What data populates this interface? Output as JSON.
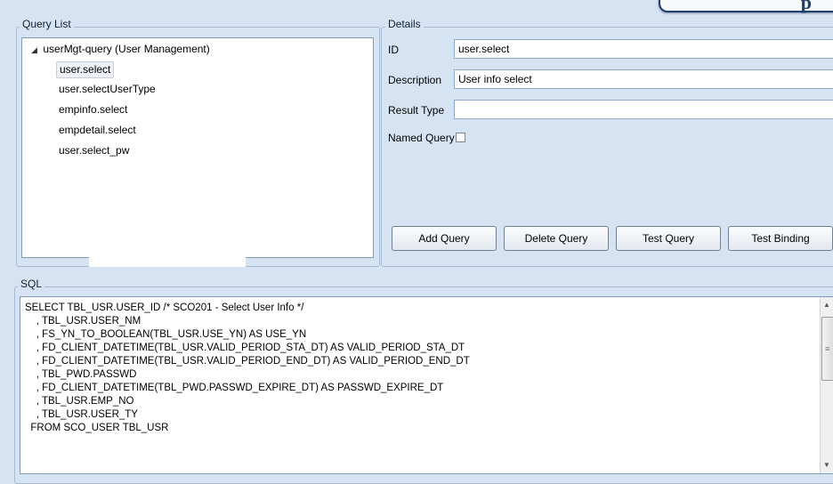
{
  "query_list": {
    "title": "Query List",
    "root": "userMgt-query (User Management)",
    "items": [
      {
        "label": "user.select",
        "selected": true
      },
      {
        "label": "user.selectUserType",
        "selected": false
      },
      {
        "label": "empinfo.select",
        "selected": false
      },
      {
        "label": "empdetail.select",
        "selected": false
      },
      {
        "label": "user.select_pw",
        "selected": false
      }
    ]
  },
  "details": {
    "title": "Details",
    "id_label": "ID",
    "id_value": "user.select",
    "description_label": "Description",
    "description_value": "User info select",
    "result_type_label": "Result Type",
    "result_type_value": "",
    "named_query_label": "Named Query",
    "named_query_checked": false,
    "buttons": {
      "add": "Add Query",
      "delete": "Delete Query",
      "test": "Test Query",
      "binding": "Test Binding"
    }
  },
  "sql": {
    "title": "SQL",
    "lines": [
      "SELECT TBL_USR.USER_ID /* SCO201 - Select User Info */",
      "    , TBL_USR.USER_NM",
      "    , FS_YN_TO_BOOLEAN(TBL_USR.USE_YN) AS USE_YN",
      "    , FD_CLIENT_DATETIME(TBL_USR.VALID_PERIOD_STA_DT) AS VALID_PERIOD_STA_DT",
      "    , FD_CLIENT_DATETIME(TBL_USR.VALID_PERIOD_END_DT) AS VALID_PERIOD_END_DT",
      "    , TBL_PWD.PASSWD",
      "    , FD_CLIENT_DATETIME(TBL_PWD.PASSWD_EXPIRE_DT) AS PASSWD_EXPIRE_DT",
      "    , TBL_USR.EMP_NO",
      "    , TBL_USR.USER_TY",
      "  FROM SCO_USER TBL_USR"
    ]
  },
  "icons": {
    "tree_expand": "triangle-down-icon",
    "scroll_up": "arrow-up-icon",
    "scroll_down": "arrow-down-icon"
  }
}
